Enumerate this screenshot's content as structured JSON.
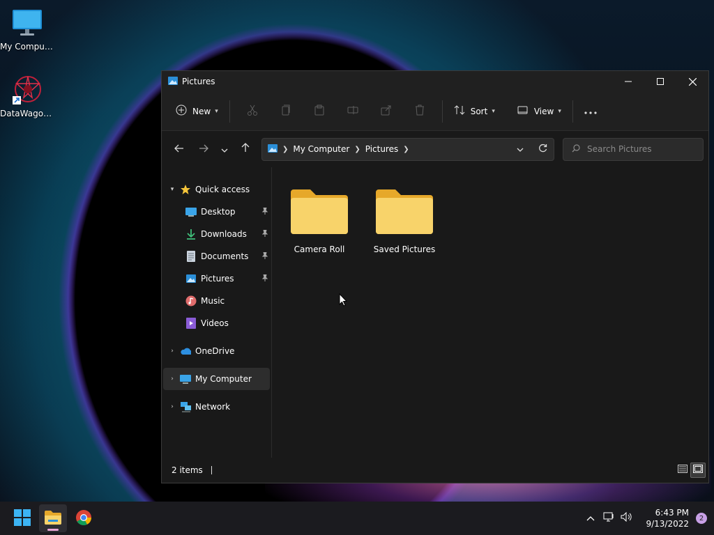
{
  "desktop": {
    "icons": [
      {
        "label": "My Computer"
      },
      {
        "label": "DataWagon..."
      }
    ]
  },
  "window": {
    "title": "Pictures",
    "toolbar": {
      "new_label": "New",
      "sort_label": "Sort",
      "view_label": "View"
    },
    "breadcrumb": [
      "My Computer",
      "Pictures"
    ],
    "search": {
      "placeholder": "Search Pictures"
    },
    "sidebar": {
      "quick_access": "Quick access",
      "quick_items": [
        {
          "label": "Desktop",
          "pinned": true
        },
        {
          "label": "Downloads",
          "pinned": true
        },
        {
          "label": "Documents",
          "pinned": true
        },
        {
          "label": "Pictures",
          "pinned": true
        },
        {
          "label": "Music",
          "pinned": false
        },
        {
          "label": "Videos",
          "pinned": false
        }
      ],
      "onedrive": "OneDrive",
      "my_computer": "My Computer",
      "network": "Network"
    },
    "folders": [
      {
        "name": "Camera Roll"
      },
      {
        "name": "Saved Pictures"
      }
    ],
    "status": {
      "items_count": "2 items"
    }
  },
  "taskbar": {
    "time": "6:43 PM",
    "date": "9/13/2022",
    "notification_count": "2"
  },
  "colors": {
    "folder": "#f8c74a",
    "accent": "#4cc2ff",
    "window_bg": "#191919"
  }
}
